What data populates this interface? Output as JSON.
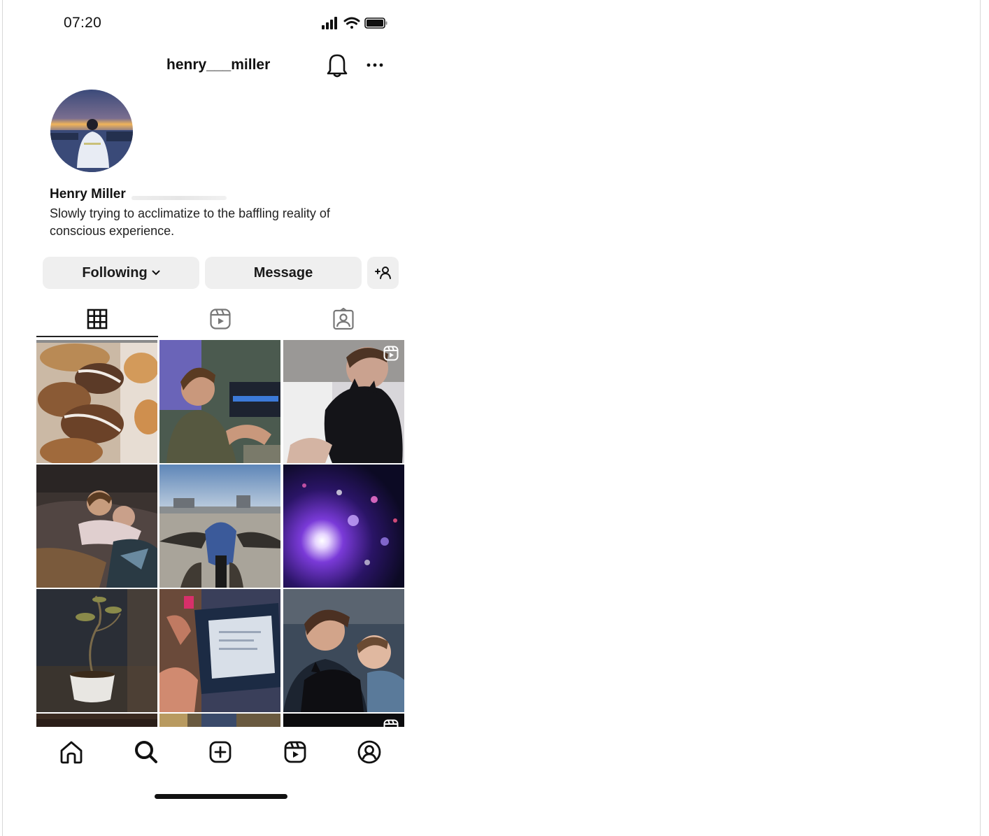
{
  "status_bar": {
    "time": "07:20",
    "icons": [
      "signal-icon",
      "wifi-icon",
      "battery-icon"
    ]
  },
  "header": {
    "username": "henry___miller",
    "icons": [
      "bell-icon",
      "more-icon"
    ]
  },
  "profile": {
    "display_name": "Henry Miller",
    "bio": "Slowly trying to acclimatize to the baffling reality of conscious experience."
  },
  "actions": {
    "following_label": "Following",
    "message_label": "Message",
    "add_person_icon": "add-person-icon"
  },
  "tabs": [
    {
      "name": "posts",
      "icon": "grid-icon",
      "active": true
    },
    {
      "name": "reels",
      "icon": "reels-icon",
      "active": false
    },
    {
      "name": "tagged",
      "icon": "tagged-icon",
      "active": false
    }
  ],
  "posts": [
    {
      "subject": "donuts",
      "reel": false
    },
    {
      "subject": "man-in-studio",
      "reel": false
    },
    {
      "subject": "man-with-black-cat",
      "reel": true
    },
    {
      "subject": "people-sleeping",
      "reel": false
    },
    {
      "subject": "motorcycle",
      "reel": false
    },
    {
      "subject": "purple-light-burst",
      "reel": false
    },
    {
      "subject": "bonsai-plant",
      "reel": false
    },
    {
      "subject": "laptop",
      "reel": false
    },
    {
      "subject": "man-cat-and-baby",
      "reel": false
    }
  ],
  "bottom_nav": [
    "home-icon",
    "search-icon",
    "create-icon",
    "reels-icon",
    "profile-icon"
  ],
  "colors": {
    "button_bg": "#efefef",
    "text": "#111111",
    "background": "#ffffff"
  }
}
